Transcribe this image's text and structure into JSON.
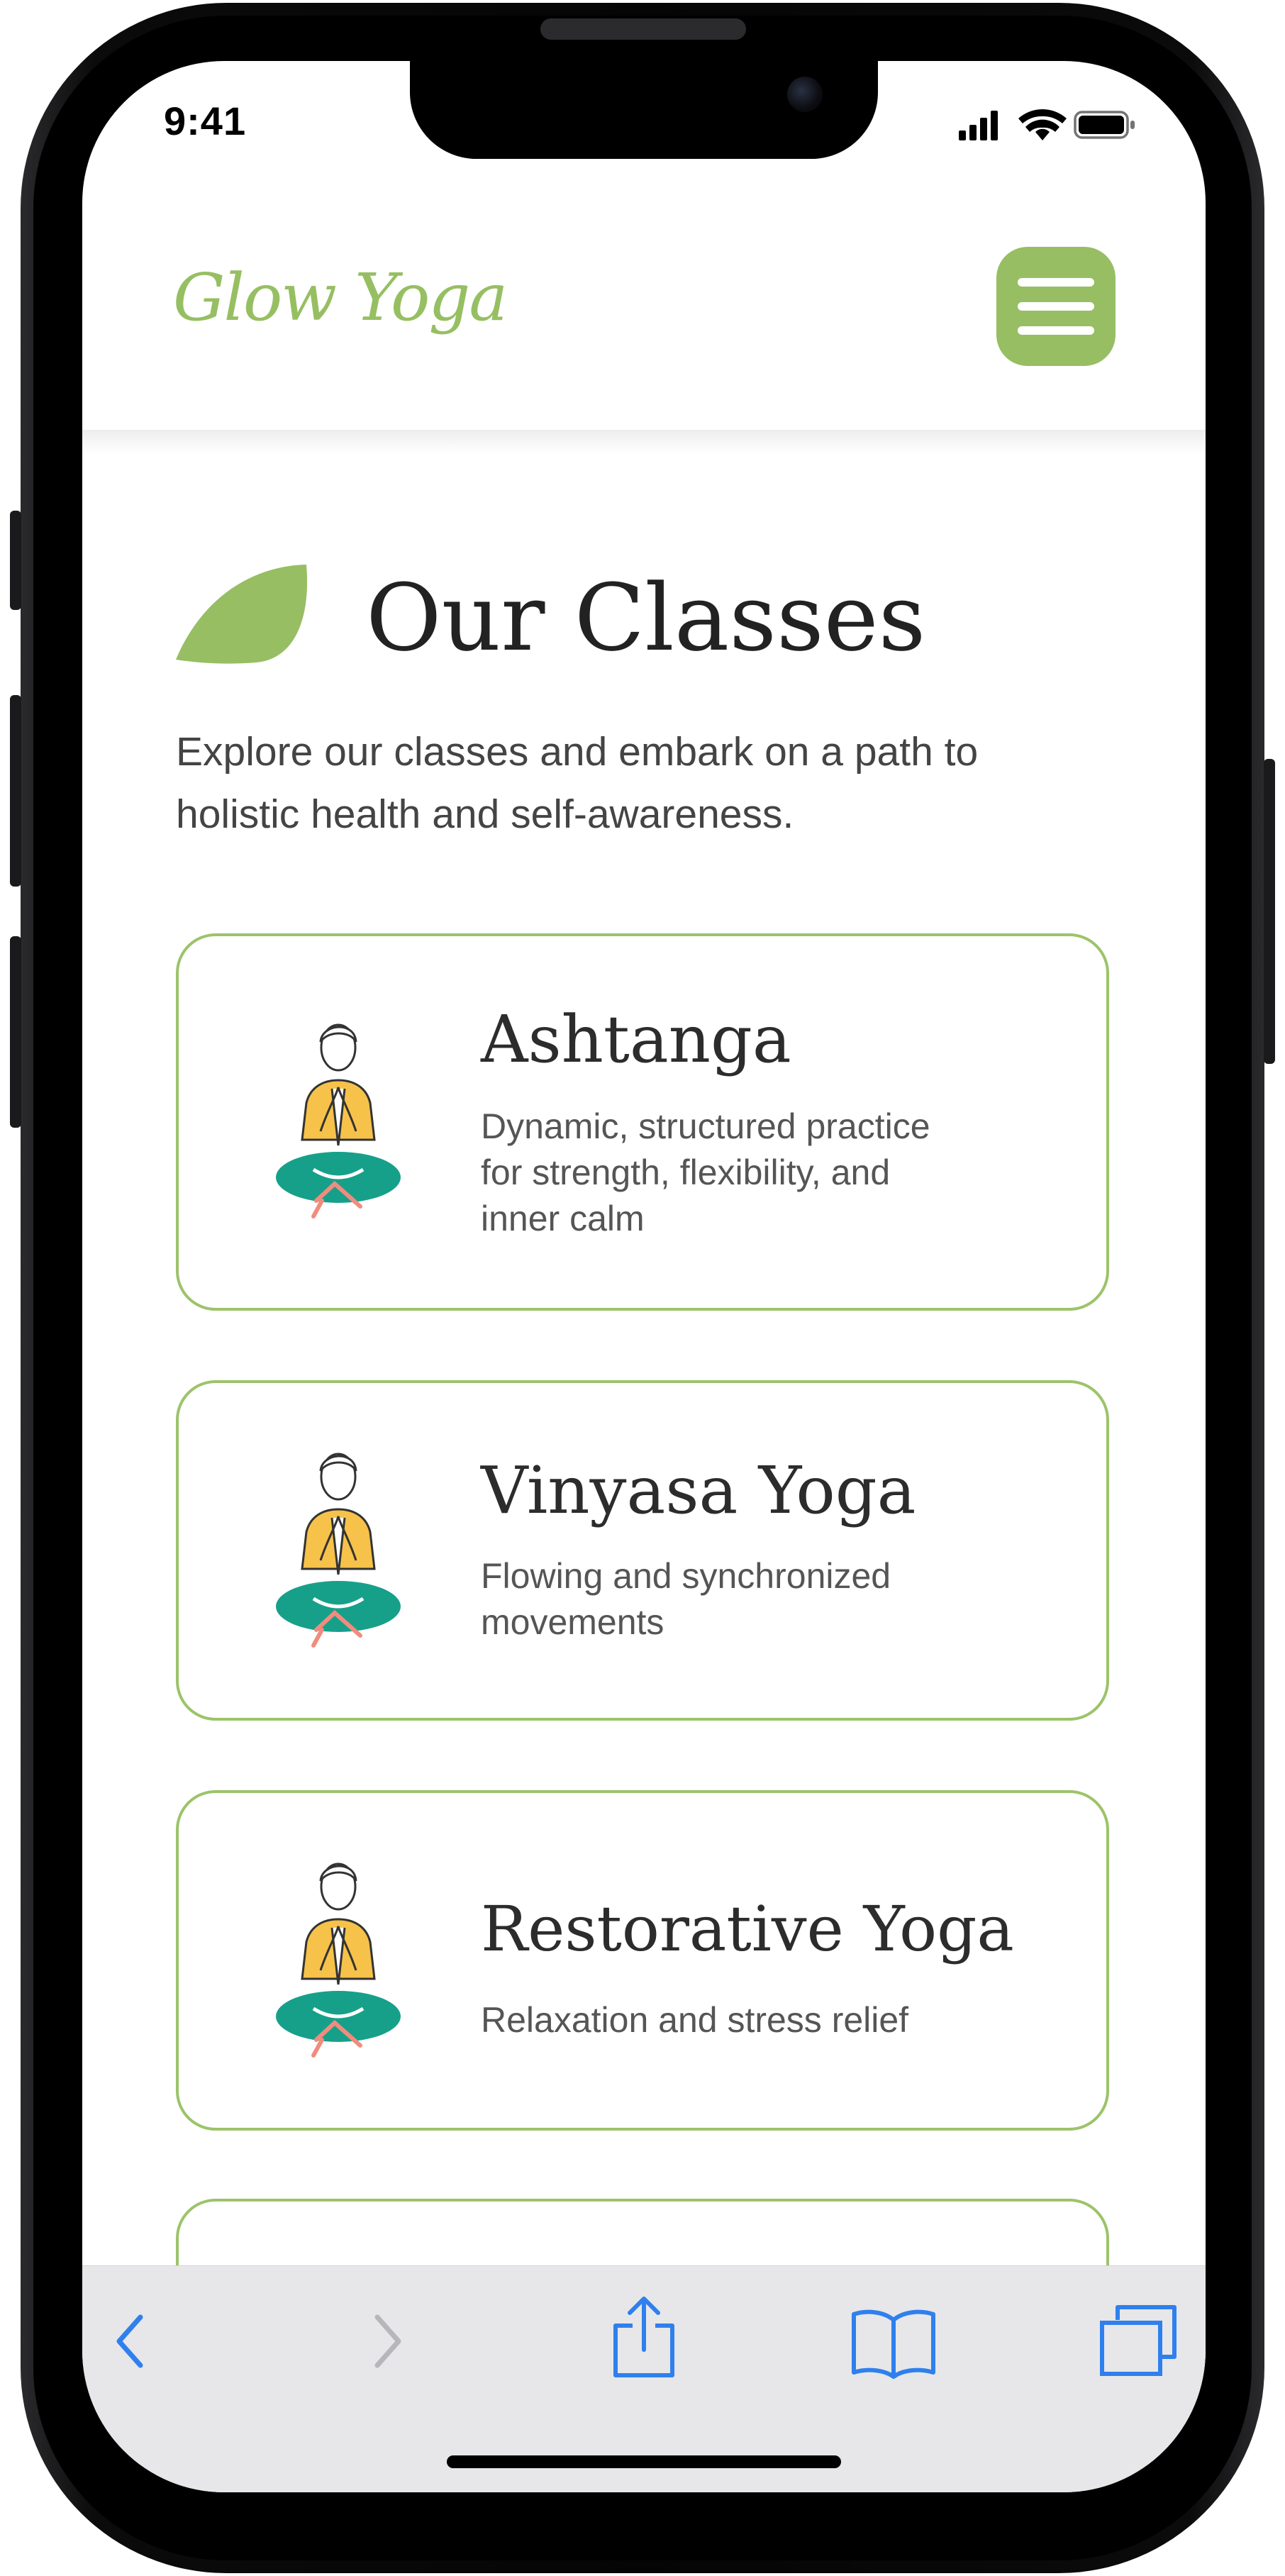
{
  "status_bar": {
    "time": "9:41"
  },
  "header": {
    "logo": "Glow Yoga",
    "menu_icon": "hamburger-menu-icon"
  },
  "page": {
    "title": "Our Classes",
    "intro_lines": [
      "Explore our classes and embark on a path to",
      "holistic health and self-awareness."
    ]
  },
  "classes": [
    {
      "name": "Ashtanga",
      "description": [
        "Dynamic, structured practice",
        "for strength, flexibility, and",
        "inner calm"
      ]
    },
    {
      "name": "Vinyasa Yoga",
      "description": [
        "Flowing and synchronized",
        "movements"
      ]
    },
    {
      "name": "Restorative Yoga",
      "description": [
        "Relaxation and stress relief"
      ]
    }
  ],
  "toolbar": {
    "icons": [
      "back-icon",
      "forward-icon",
      "share-icon",
      "bookmarks-icon",
      "tabs-icon"
    ]
  },
  "colors": {
    "brand_green": "#97be63",
    "card_border": "#9cc36a",
    "figure_teal": "#16a08a",
    "figure_yellow": "#f6c24a",
    "figure_pink": "#f08c7e",
    "safari_blue": "#2f80ed"
  }
}
